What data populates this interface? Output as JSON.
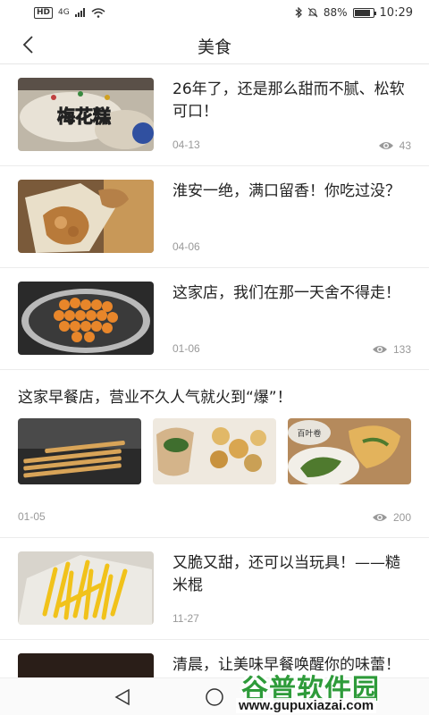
{
  "status_bar": {
    "network_badge": "HD",
    "signal_label": "4G",
    "battery_pct": "88%",
    "battery_level": 0.88,
    "time": "10:29"
  },
  "app_bar": {
    "title": "美食",
    "back_icon": "chevron-left-icon"
  },
  "feed": [
    {
      "title": "26年了，还是那么甜而不腻、松软可口！",
      "date": "04-13",
      "views": "43",
      "thumb_text": "梅花糕"
    },
    {
      "title": "淮安一绝，满口留香！你吃过没？",
      "date": "04-06",
      "views": ""
    },
    {
      "title": "这家店，我们在那一天舍不得走！",
      "date": "01-06",
      "views": "133"
    },
    {
      "title": "这家早餐店，营业不久人气就火到“爆”！",
      "date": "01-05",
      "views": "200",
      "multi_image_sign": "百叶卷"
    },
    {
      "title": "又脆又甜，还可以当玩具！——糙米棍",
      "date": "11-27",
      "views": ""
    },
    {
      "title": "清晨，让美味早餐唤醒你的味蕾！",
      "date": "",
      "views": ""
    }
  ],
  "watermark": {
    "name": "谷普软件园",
    "url": "www.gupuxiazai.com"
  },
  "colors": {
    "watermark_green": "#2e9b3a",
    "meta_gray": "#999999"
  }
}
